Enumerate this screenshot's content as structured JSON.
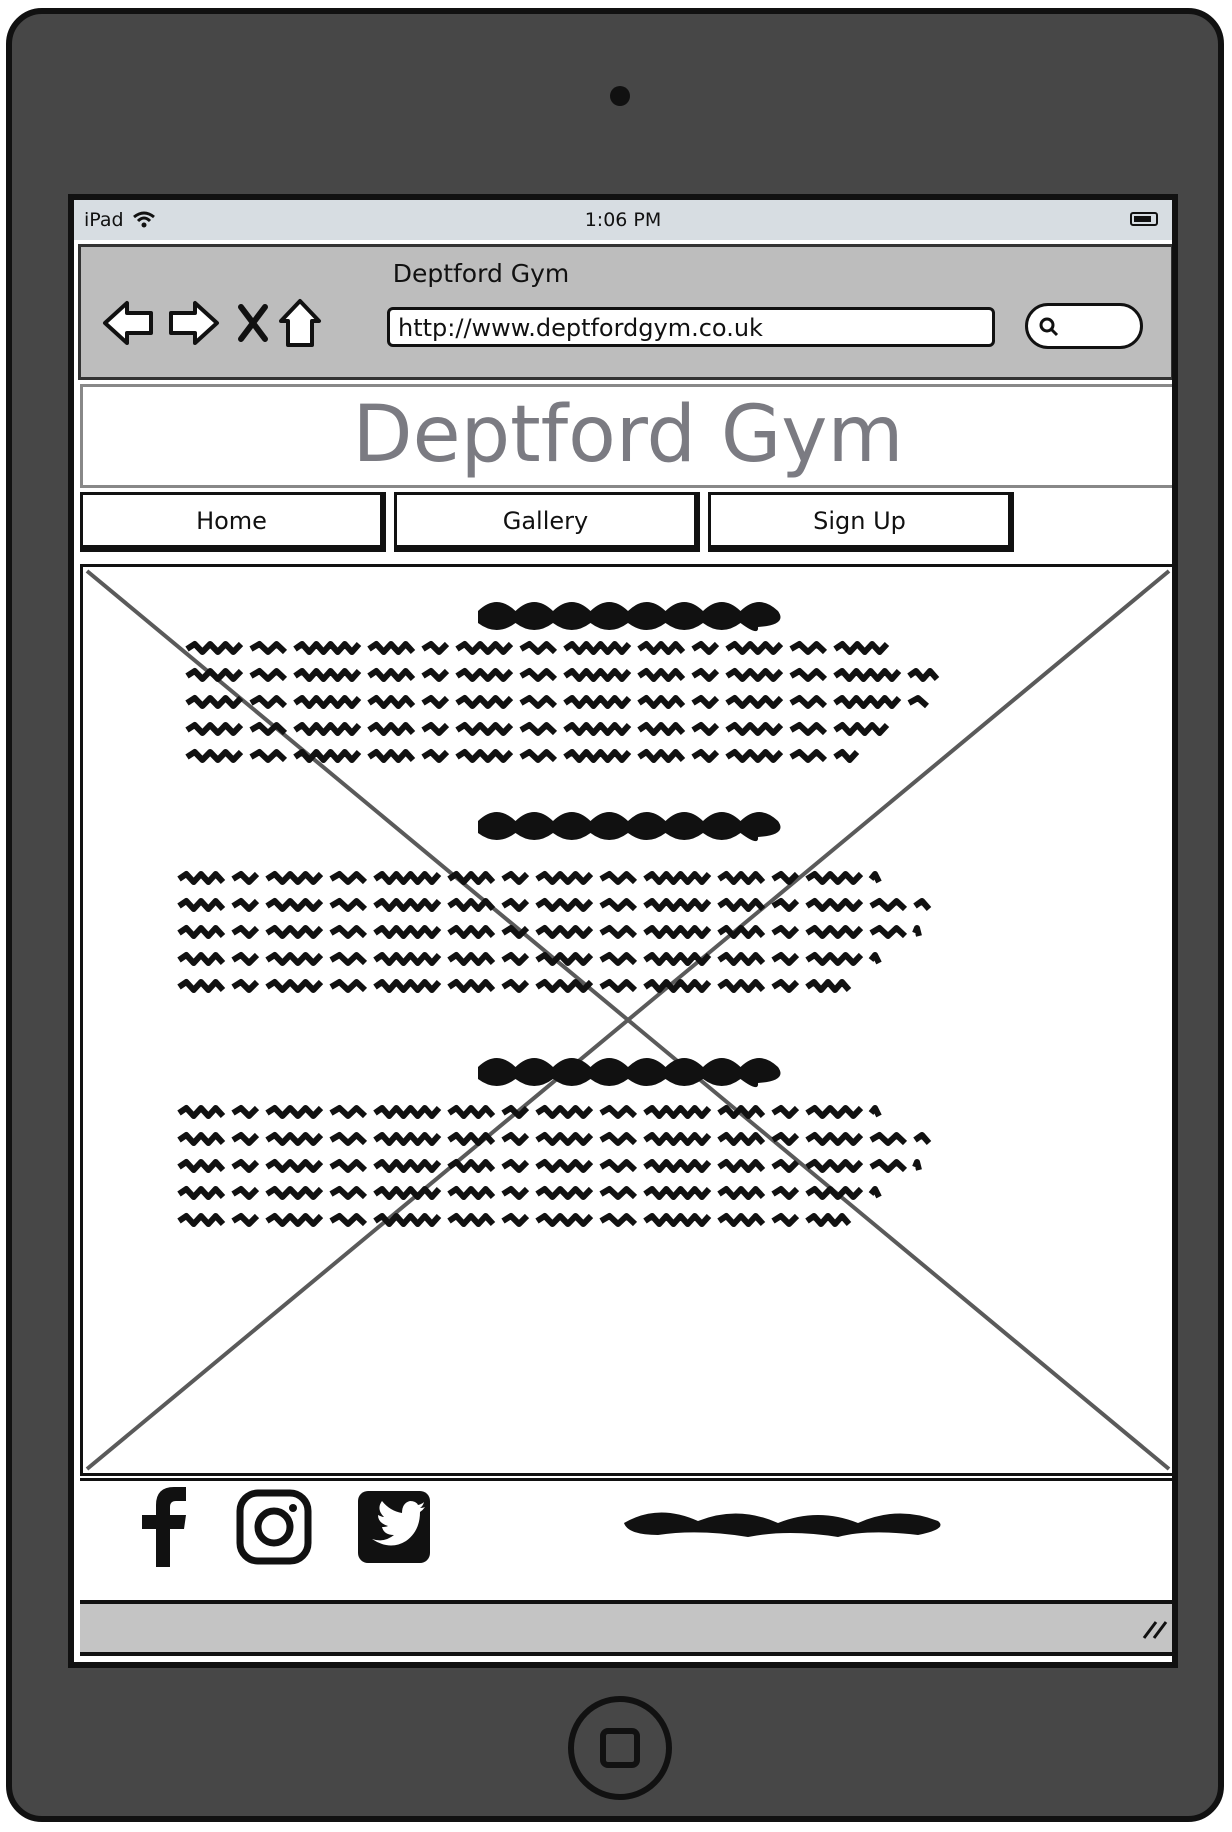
{
  "device": {
    "name": "iPad"
  },
  "statusbar": {
    "carrier": "iPad",
    "time": "1:06 PM"
  },
  "browser": {
    "window_title": "Deptford Gym",
    "url": "http://www.deptfordgym.co.uk"
  },
  "site": {
    "title": "Deptford Gym",
    "nav": [
      {
        "label": "Home"
      },
      {
        "label": "Gallery"
      },
      {
        "label": "Sign Up"
      }
    ]
  },
  "icons": {
    "back": "back-arrow-icon",
    "forward": "forward-arrow-icon",
    "stop": "close-icon",
    "home": "home-icon",
    "search": "search-icon",
    "facebook": "facebook-icon",
    "instagram": "instagram-icon",
    "twitter": "twitter-icon"
  }
}
